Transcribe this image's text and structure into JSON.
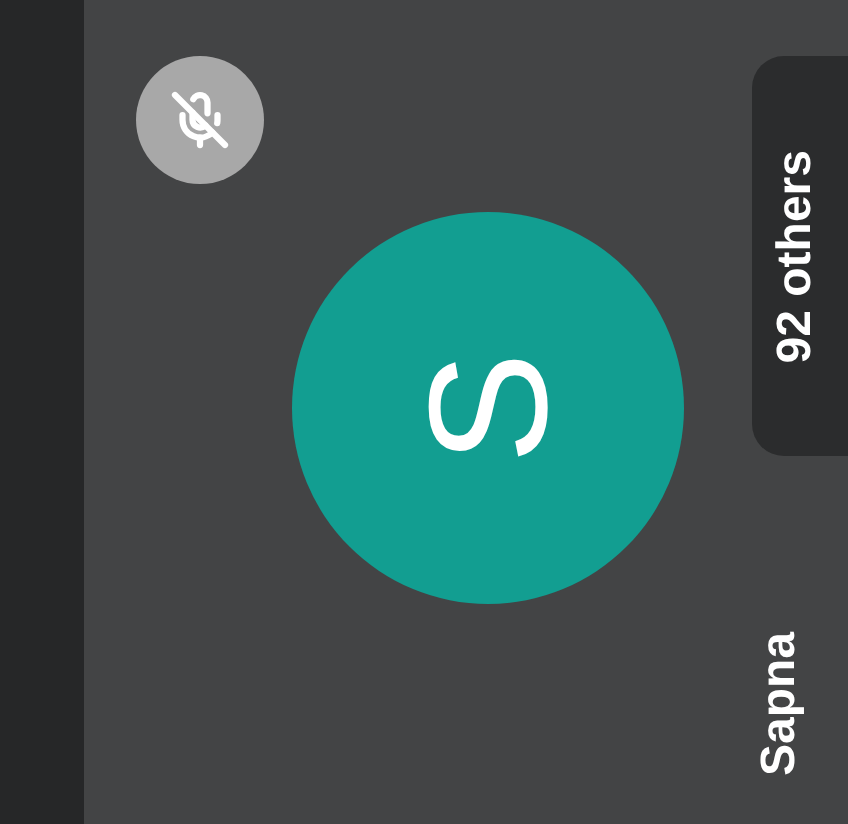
{
  "tile": {
    "name": "Sapna",
    "initial": "S",
    "muted": true,
    "color": "#129e91"
  },
  "others": {
    "label": "92 others"
  }
}
